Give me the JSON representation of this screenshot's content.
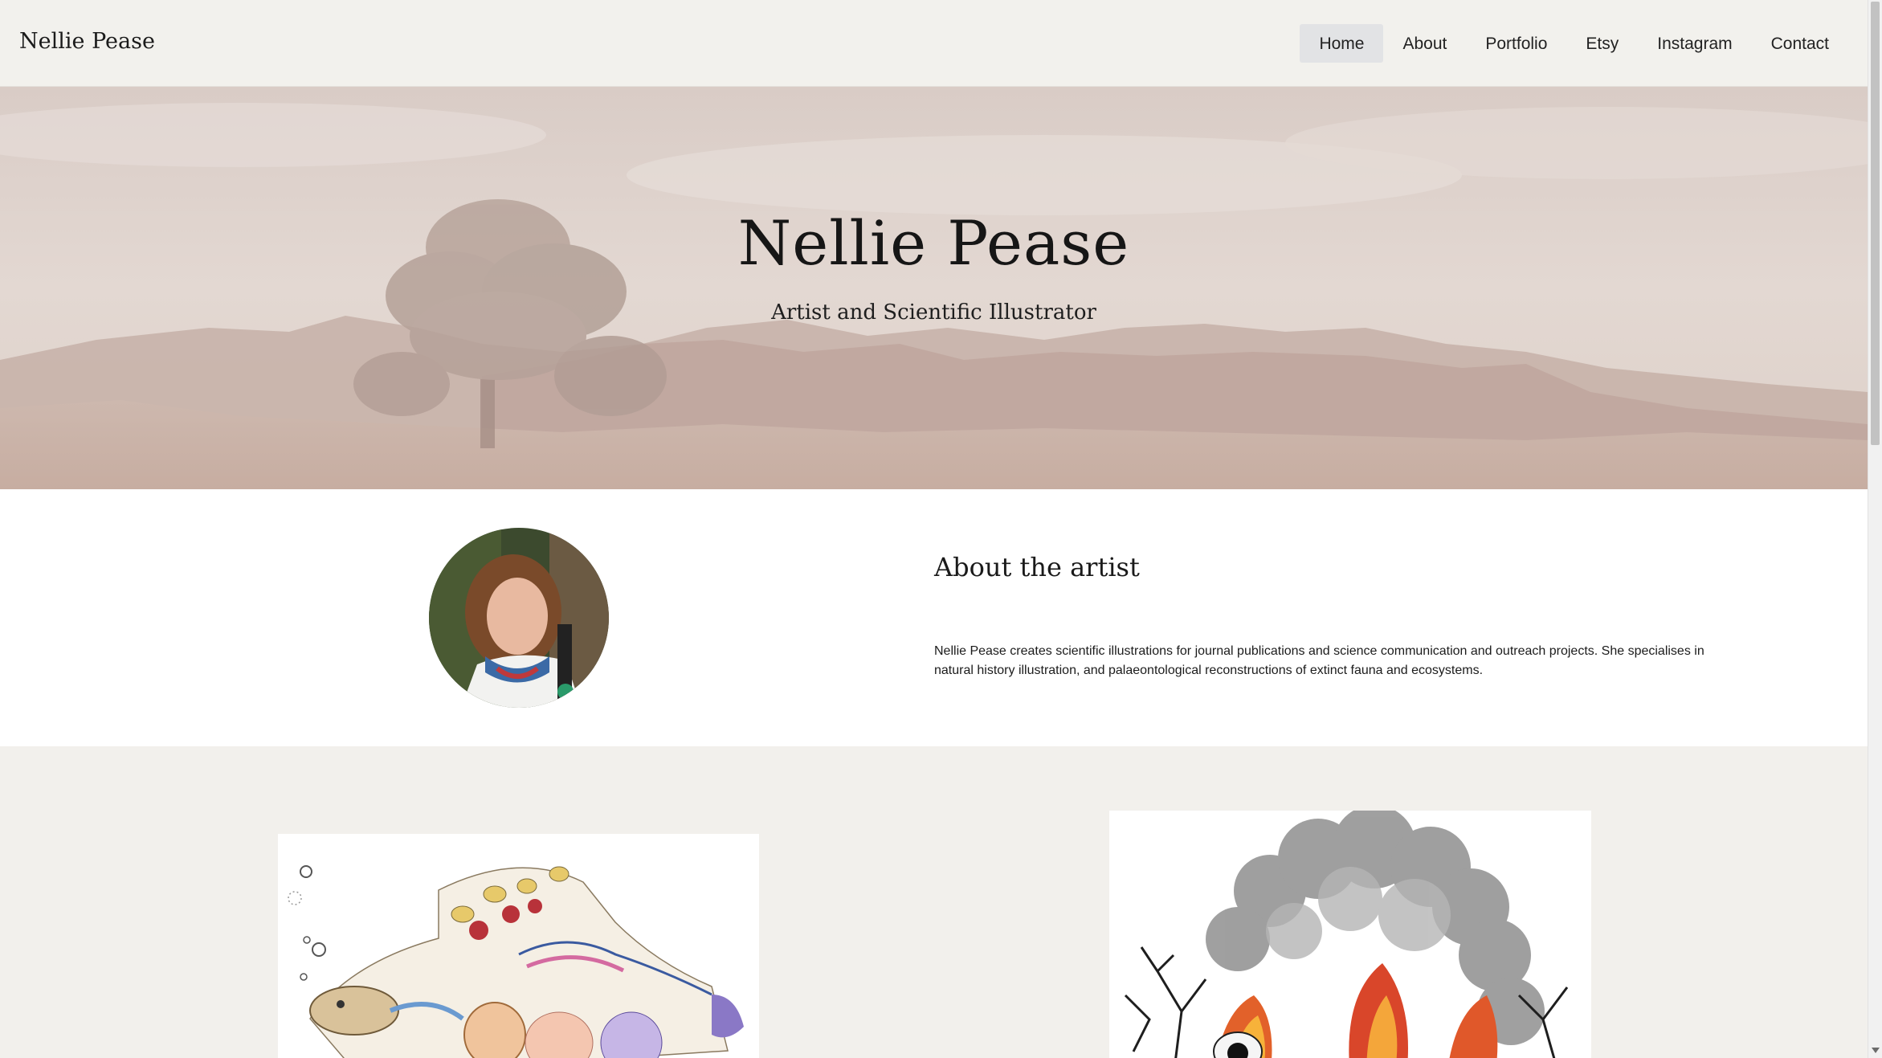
{
  "header": {
    "brand": "Nellie Pease",
    "nav": [
      {
        "label": "Home",
        "active": true
      },
      {
        "label": "About",
        "active": false
      },
      {
        "label": "Portfolio",
        "active": false
      },
      {
        "label": "Etsy",
        "active": false
      },
      {
        "label": "Instagram",
        "active": false
      },
      {
        "label": "Contact",
        "active": false
      }
    ]
  },
  "hero": {
    "title": "Nellie Pease",
    "subtitle": "Artist and Scientific Illustrator"
  },
  "about": {
    "title": "About the artist",
    "text": "Nellie Pease creates scientific illustrations for journal publications and science communication and outreach projects. She specialises in natural history illustration, and palaeontological reconstructions of extinct fauna and ecosystems."
  },
  "colors": {
    "header_bg": "#f2f1ed",
    "nav_active_bg": "#e2e3e5",
    "page_bg": "#f2f0ec",
    "about_bg": "#ffffff"
  }
}
